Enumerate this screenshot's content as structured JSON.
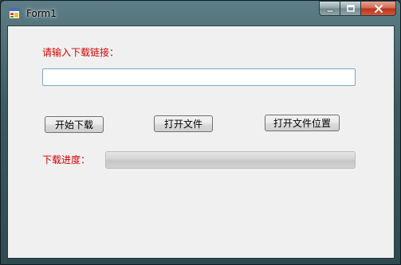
{
  "window": {
    "title": "Form1",
    "icons": {
      "app": "form-app-icon",
      "minimize": "minimize-icon",
      "maximize": "maximize-icon",
      "close": "close-icon"
    }
  },
  "form": {
    "url_label": "请输入下载链接：",
    "url_input": {
      "value": "",
      "placeholder": ""
    },
    "buttons": {
      "start_download": "开始下载",
      "open_file": "打开文件",
      "open_file_location": "打开文件位置"
    },
    "progress_label": "下载进度：",
    "progress": {
      "value_percent": 0
    }
  },
  "colors": {
    "label_red": "#d40000",
    "client_bg": "#f0f0f0",
    "frame": "#3d5a60"
  }
}
